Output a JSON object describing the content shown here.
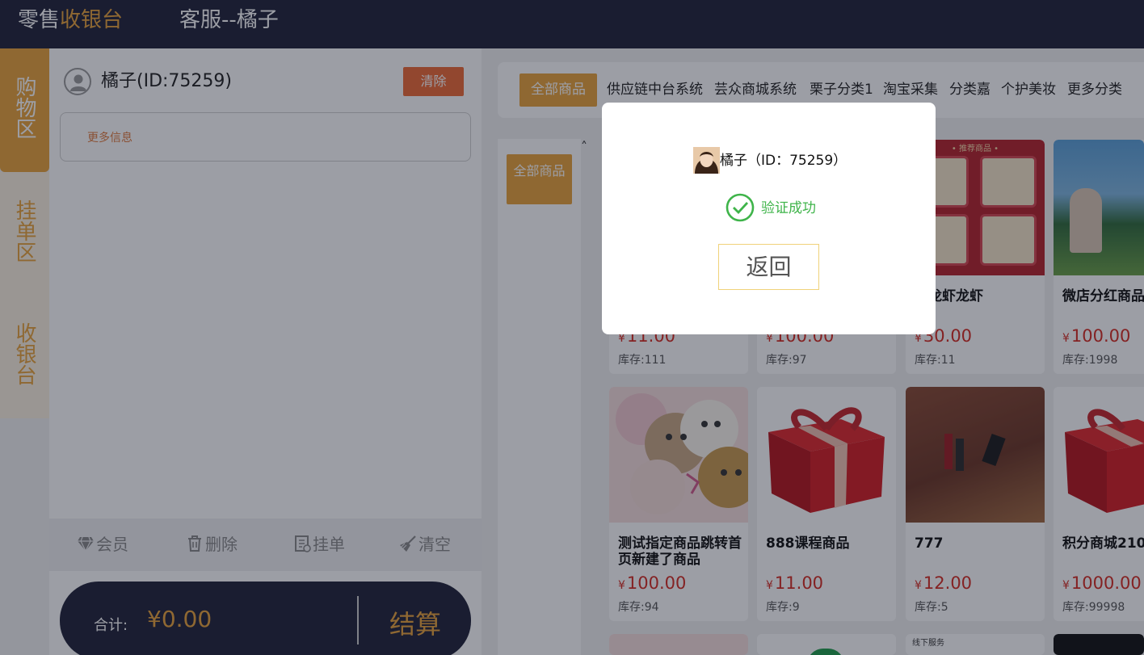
{
  "header": {
    "brand_part1": "零售",
    "brand_part2": "收银台",
    "title": "客服--橘子"
  },
  "sidenav": {
    "items": [
      {
        "label": "购物区",
        "active": true
      },
      {
        "label": "挂单区",
        "active": false
      },
      {
        "label": "收银台",
        "active": false
      }
    ]
  },
  "cart": {
    "member_name": "橘子(ID:75259)",
    "clear_label": "清除",
    "more_info_label": "更多信息",
    "toolbar": {
      "member_label": "会员",
      "delete_label": "删除",
      "hold_label": "挂单",
      "empty_label": "清空"
    },
    "total_label": "合计:",
    "total_value": "¥0.00",
    "checkout_label": "结算"
  },
  "categories": {
    "all_label": "全部商品",
    "items": [
      "供应链中台系统",
      "芸众商城系统",
      "栗子分类1",
      "淘宝采集",
      "分类嘉",
      "个护美妆",
      "更多分类"
    ]
  },
  "subcategory": {
    "all_label": "全部商品"
  },
  "products": [
    {
      "name": "",
      "price": "11.00",
      "stock": "库存:111"
    },
    {
      "name": "",
      "price": "100.00",
      "stock": "库存:97"
    },
    {
      "name": "虾龙虾龙虾",
      "price": "30.00",
      "stock": "库存:11"
    },
    {
      "name": "微店分红商品",
      "price": "100.00",
      "stock": "库存:1998"
    },
    {
      "name": "测试指定商品跳转首页新建了商品",
      "price": "100.00",
      "stock": "库存:94"
    },
    {
      "name": "888课程商品",
      "price": "11.00",
      "stock": "库存:9"
    },
    {
      "name": "777",
      "price": "12.00",
      "stock": "库存:5"
    },
    {
      "name": "积分商城210",
      "price": "1000.00",
      "stock": "库存:99998"
    }
  ],
  "currency_symbol": "¥",
  "thumbnail_text": {
    "recommend_banner": "• 推荐商品 •",
    "offline_service": "线下服务"
  },
  "modal": {
    "user_label": "橘子（ID：75259）",
    "status_text": "验证成功",
    "back_label": "返回"
  },
  "colors": {
    "header_bg": "#1f2237",
    "accent": "#e8a33a",
    "danger": "#ee6a35",
    "price": "#d62a20",
    "success": "#3fb44a"
  }
}
